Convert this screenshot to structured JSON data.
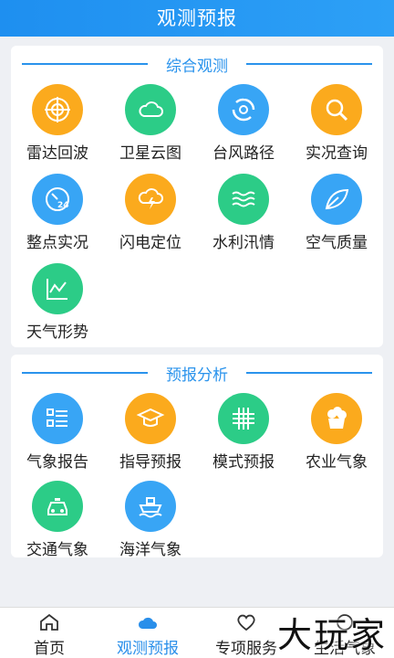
{
  "header": {
    "title": "观测预报"
  },
  "observation": {
    "title": "综合观测",
    "items": [
      {
        "label": "雷达回波",
        "icon": "radar-icon",
        "color": "#fbaa1d"
      },
      {
        "label": "卫星云图",
        "icon": "cloud-icon",
        "color": "#2ccc87"
      },
      {
        "label": "台风路径",
        "icon": "typhoon-icon",
        "color": "#38a5f5"
      },
      {
        "label": "实况查询",
        "icon": "search-icon",
        "color": "#fbaa1d"
      },
      {
        "label": "整点实况",
        "icon": "clock-24-icon",
        "color": "#38a5f5"
      },
      {
        "label": "闪电定位",
        "icon": "lightning-cloud-icon",
        "color": "#fbaa1d"
      },
      {
        "label": "水利汛情",
        "icon": "water-waves-icon",
        "color": "#2ccc87"
      },
      {
        "label": "空气质量",
        "icon": "leaf-icon",
        "color": "#38a5f5"
      },
      {
        "label": "天气形势",
        "icon": "trend-chart-icon",
        "color": "#2ccc87"
      }
    ]
  },
  "forecast": {
    "title": "预报分析",
    "items": [
      {
        "label": "气象报告",
        "icon": "report-list-icon",
        "color": "#38a5f5"
      },
      {
        "label": "指导预报",
        "icon": "graduation-cap-icon",
        "color": "#fbaa1d"
      },
      {
        "label": "模式预报",
        "icon": "grid-icon",
        "color": "#2ccc87"
      },
      {
        "label": "农业气象",
        "icon": "farm-basket-icon",
        "color": "#fbaa1d"
      },
      {
        "label": "交通气象",
        "icon": "car-icon",
        "color": "#2ccc87"
      },
      {
        "label": "海洋气象",
        "icon": "ship-icon",
        "color": "#38a5f5"
      }
    ]
  },
  "tabs": [
    {
      "label": "首页",
      "icon": "home-icon",
      "active": false
    },
    {
      "label": "观测预报",
      "icon": "cloud-icon",
      "active": true
    },
    {
      "label": "专项服务",
      "icon": "heart-icon",
      "active": false
    },
    {
      "label": "生活气象",
      "icon": "life-icon",
      "active": false
    }
  ],
  "colors": {
    "accent": "#2a93ec",
    "orange": "#fbaa1d",
    "green": "#2ccc87",
    "blue": "#38a5f5"
  },
  "watermark": "大玩家"
}
